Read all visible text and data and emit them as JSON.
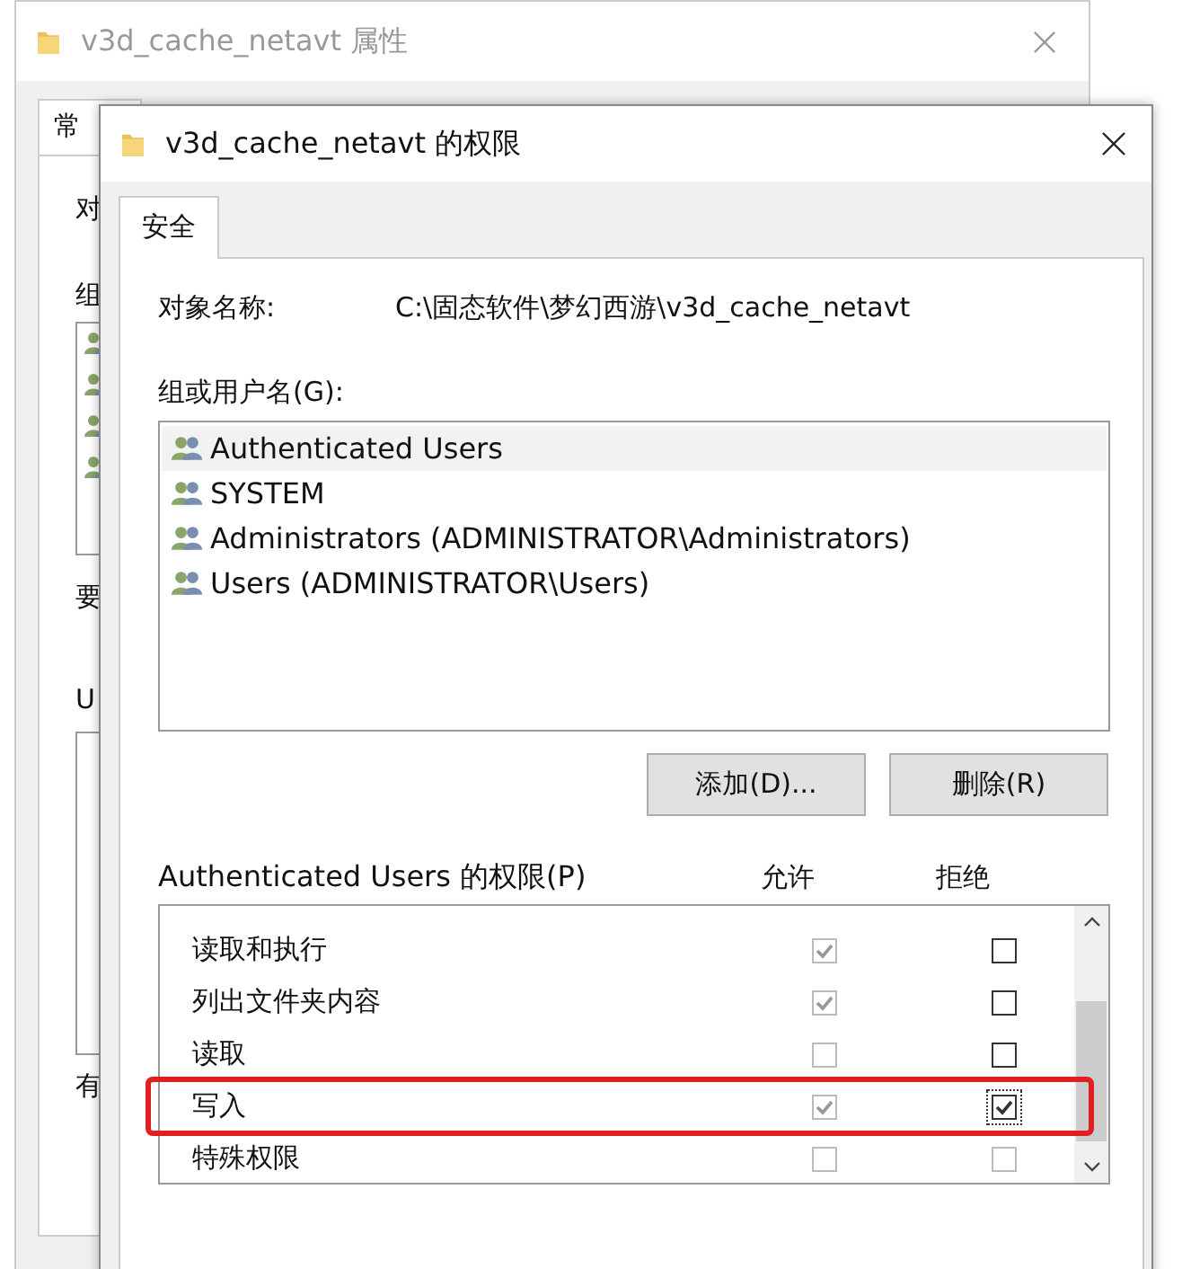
{
  "back_window": {
    "title": "v3d_cache_netavt 属性",
    "tab": "常",
    "labels": [
      "对",
      "组",
      "要",
      "U",
      "有"
    ]
  },
  "dialog": {
    "title": "v3d_cache_netavt 的权限",
    "tabs": [
      {
        "label": "安全",
        "selected": true
      }
    ],
    "object_label": "对象名称:",
    "object_value": "C:\\固态软件\\梦幻西游\\v3d_cache_netavt",
    "group_label": "组或用户名(G):",
    "users": [
      {
        "name": "Authenticated Users",
        "selected": true
      },
      {
        "name": "SYSTEM",
        "selected": false
      },
      {
        "name": "Administrators (ADMINISTRATOR\\Administrators)",
        "selected": false
      },
      {
        "name": "Users (ADMINISTRATOR\\Users)",
        "selected": false
      }
    ],
    "buttons": [
      "添加(D)...",
      "删除(R)"
    ],
    "permissions_label": "Authenticated Users 的权限(P)",
    "columns": [
      "允许",
      "拒绝"
    ],
    "permissions": [
      {
        "name": "读取和执行",
        "allow": true,
        "allow_disabled": true,
        "deny": false,
        "deny_disabled": false,
        "highlighted": false
      },
      {
        "name": "列出文件夹内容",
        "allow": true,
        "allow_disabled": true,
        "deny": false,
        "deny_disabled": false,
        "highlighted": false
      },
      {
        "name": "读取",
        "allow": false,
        "allow_disabled": true,
        "deny": false,
        "deny_disabled": false,
        "highlighted": false
      },
      {
        "name": "写入",
        "allow": true,
        "allow_disabled": true,
        "deny": true,
        "deny_disabled": false,
        "highlighted": true
      },
      {
        "name": "特殊权限",
        "allow": false,
        "allow_disabled": true,
        "deny": false,
        "deny_disabled": true,
        "highlighted": false
      }
    ]
  }
}
